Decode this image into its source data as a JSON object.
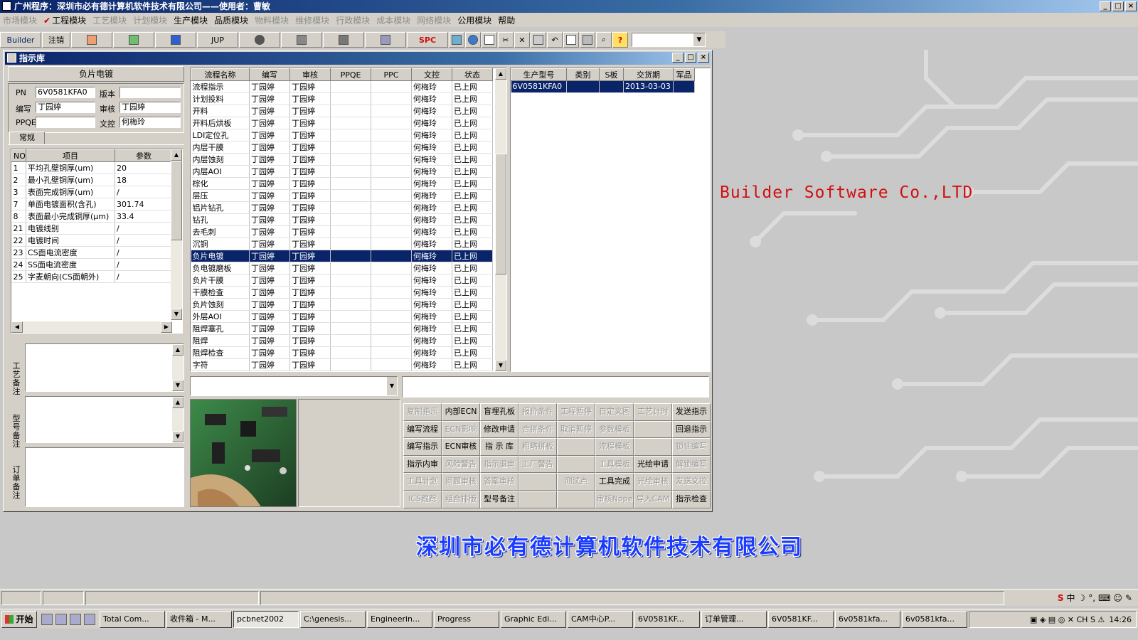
{
  "window": {
    "title": "广州程序：深圳市必有德计算机软件技术有限公司——使用者：曹敏"
  },
  "menu": [
    {
      "label": "市场模块",
      "enabled": false
    },
    {
      "label": "工程模块",
      "enabled": true,
      "checked": true
    },
    {
      "label": "工艺模块",
      "enabled": false
    },
    {
      "label": "计划模块",
      "enabled": false
    },
    {
      "label": "生产模块",
      "enabled": true
    },
    {
      "label": "品质模块",
      "enabled": true
    },
    {
      "label": "物料模块",
      "enabled": false
    },
    {
      "label": "维修模块",
      "enabled": false
    },
    {
      "label": "行政模块",
      "enabled": false
    },
    {
      "label": "成本模块",
      "enabled": false
    },
    {
      "label": "网络模块",
      "enabled": false
    },
    {
      "label": "公用模块",
      "enabled": true
    },
    {
      "label": "帮助",
      "enabled": true
    }
  ],
  "toolbar": {
    "builder_label": "Builder",
    "logout_label": "注销",
    "jup_label": "JUP",
    "spc_label": "SPC",
    "help_label": "?"
  },
  "child_window": {
    "title": "指示库"
  },
  "left_panel": {
    "header": "负片电镀",
    "pn_label": "PN",
    "pn_value": "6V0581KFA0",
    "version_label": "版本",
    "version_value": "",
    "author_label": "编写",
    "author_value": "丁园婷",
    "reviewer_label": "审核",
    "reviewer_value": "丁园婷",
    "ppqe_label": "PPQE",
    "ppqe_value": "",
    "doc_control_label": "文控",
    "doc_control_value": "何梅玲",
    "tab": "常规",
    "param_columns": [
      "NO",
      "项目",
      "参数"
    ],
    "params": [
      {
        "no": "1",
        "item": "平均孔壁铜厚(um)",
        "value": "20"
      },
      {
        "no": "2",
        "item": "最小孔壁铜厚(um)",
        "value": "18"
      },
      {
        "no": "3",
        "item": "表面完成铜厚(um)",
        "value": "/"
      },
      {
        "no": "7",
        "item": "单面电镀面积(含孔)",
        "value": "301.74"
      },
      {
        "no": "8",
        "item": "表面最小完成铜厚(μm)",
        "value": "33.4"
      },
      {
        "no": "21",
        "item": "电镀线别",
        "value": "/"
      },
      {
        "no": "22",
        "item": "电镀时间",
        "value": "/"
      },
      {
        "no": "23",
        "item": "CS面电流密度",
        "value": "/"
      },
      {
        "no": "24",
        "item": "SS面电流密度",
        "value": "/"
      },
      {
        "no": "25",
        "item": "字麦朝向(CS面朝外)",
        "value": "/"
      }
    ],
    "remark_labels": [
      "工艺备注",
      "型号备注",
      "订单备注"
    ]
  },
  "process_table": {
    "columns": [
      "流程名称",
      "编写",
      "审核",
      "PPQE",
      "PPC",
      "文控",
      "状态"
    ],
    "selected_index": 14,
    "rows": [
      [
        "流程指示",
        "丁园婷",
        "丁园婷",
        "",
        "",
        "何梅玲",
        "已上网"
      ],
      [
        "计划投料",
        "丁园婷",
        "丁园婷",
        "",
        "",
        "何梅玲",
        "已上网"
      ],
      [
        "开料",
        "丁园婷",
        "丁园婷",
        "",
        "",
        "何梅玲",
        "已上网"
      ],
      [
        "开料后烘板",
        "丁园婷",
        "丁园婷",
        "",
        "",
        "何梅玲",
        "已上网"
      ],
      [
        "LDI定位孔",
        "丁园婷",
        "丁园婷",
        "",
        "",
        "何梅玲",
        "已上网"
      ],
      [
        "内层干膜",
        "丁园婷",
        "丁园婷",
        "",
        "",
        "何梅玲",
        "已上网"
      ],
      [
        "内层蚀刻",
        "丁园婷",
        "丁园婷",
        "",
        "",
        "何梅玲",
        "已上网"
      ],
      [
        "内层AOI",
        "丁园婷",
        "丁园婷",
        "",
        "",
        "何梅玲",
        "已上网"
      ],
      [
        "棕化",
        "丁园婷",
        "丁园婷",
        "",
        "",
        "何梅玲",
        "已上网"
      ],
      [
        "层压",
        "丁园婷",
        "丁园婷",
        "",
        "",
        "何梅玲",
        "已上网"
      ],
      [
        "铝片钻孔",
        "丁园婷",
        "丁园婷",
        "",
        "",
        "何梅玲",
        "已上网"
      ],
      [
        "钻孔",
        "丁园婷",
        "丁园婷",
        "",
        "",
        "何梅玲",
        "已上网"
      ],
      [
        "去毛刺",
        "丁园婷",
        "丁园婷",
        "",
        "",
        "何梅玲",
        "已上网"
      ],
      [
        "沉铜",
        "丁园婷",
        "丁园婷",
        "",
        "",
        "何梅玲",
        "已上网"
      ],
      [
        "负片电镀",
        "丁园婷",
        "丁园婷",
        "",
        "",
        "何梅玲",
        "已上网"
      ],
      [
        "负电镀磨板",
        "丁园婷",
        "丁园婷",
        "",
        "",
        "何梅玲",
        "已上网"
      ],
      [
        "负片干膜",
        "丁园婷",
        "丁园婷",
        "",
        "",
        "何梅玲",
        "已上网"
      ],
      [
        "干膜检查",
        "丁园婷",
        "丁园婷",
        "",
        "",
        "何梅玲",
        "已上网"
      ],
      [
        "负片蚀刻",
        "丁园婷",
        "丁园婷",
        "",
        "",
        "何梅玲",
        "已上网"
      ],
      [
        "外层AOI",
        "丁园婷",
        "丁园婷",
        "",
        "",
        "何梅玲",
        "已上网"
      ],
      [
        "阻焊塞孔",
        "丁园婷",
        "丁园婷",
        "",
        "",
        "何梅玲",
        "已上网"
      ],
      [
        "阻焊",
        "丁园婷",
        "丁园婷",
        "",
        "",
        "何梅玲",
        "已上网"
      ],
      [
        "阻焊检查",
        "丁园婷",
        "丁园婷",
        "",
        "",
        "何梅玲",
        "已上网"
      ],
      [
        "字符",
        "丁园婷",
        "丁园婷",
        "",
        "",
        "何梅玲",
        "已上网"
      ]
    ]
  },
  "model_table": {
    "columns": [
      "生产型号",
      "类别",
      "S板",
      "交货期",
      "军品"
    ],
    "rows": [
      [
        "6V0581KFA0",
        "",
        "",
        "2013-03-03",
        ""
      ]
    ]
  },
  "action_buttons": [
    [
      "复制指示",
      "内部ECN",
      "盲埋孔板",
      "报价条件",
      "工程暂停",
      "自定义图",
      "工艺计时",
      "发送指示"
    ],
    [
      "编写流程",
      "ECN影响",
      "修改申请",
      "合拼条件",
      "取消暂停",
      "参数模板",
      "",
      "回退指示"
    ],
    [
      "编写指示",
      "ECN审核",
      "指 示 库",
      "粗略拼板",
      "",
      "流程模板",
      "",
      "锁住编写"
    ],
    [
      "指示内审",
      "风险警告",
      "指示退审",
      "工厂警告",
      "",
      "工具模板",
      "光绘申请",
      "解锁编写"
    ],
    [
      "工具计划",
      "问题审核",
      "答案审核",
      "",
      "测试点",
      "工具完成",
      "光绘审核",
      "发送文控"
    ],
    [
      "ICS跟踪",
      "组合排版",
      "型号备注",
      "",
      "",
      "审核Nope",
      "导入CAM",
      "指示检查"
    ]
  ],
  "disabled_buttons": [
    "复制指示",
    "ECN影响",
    "报价条件",
    "工程暂停",
    "自定义图",
    "工艺计时",
    "合拼条件",
    "取消暂停",
    "参数模板",
    "粗略拼板",
    "流程模板",
    "锁住编写",
    "风险警告",
    "指示退审",
    "工厂警告",
    "工具模板",
    "解锁编写",
    "工具计划",
    "问题审核",
    "答案审核",
    "测试点",
    "光绘审核",
    "发送文控",
    "ICS跟踪",
    "组合排版",
    "审核Nope",
    "导入CAM"
  ],
  "background": {
    "brand_text": "Builder Software Co.,LTD",
    "company_text": "深圳市必有德计算机软件技术有限公司",
    "brand_color": "#d01010",
    "company_color": "#1a3cff"
  },
  "taskbar": {
    "start_label": "开始",
    "tasks": [
      "Total Com...",
      "收件箱 - M...",
      "pcbnet2002",
      "C:\\genesis...",
      "Engineerin...",
      "Progress",
      "Graphic Edi...",
      "CAM中心P...",
      "6V0581KF...",
      "订单管理...",
      "6V0581KF...",
      "6v0581kfa...",
      "6v0581kfa..."
    ],
    "active_task_index": 2,
    "clock": "14:26",
    "ime_label": "中"
  }
}
